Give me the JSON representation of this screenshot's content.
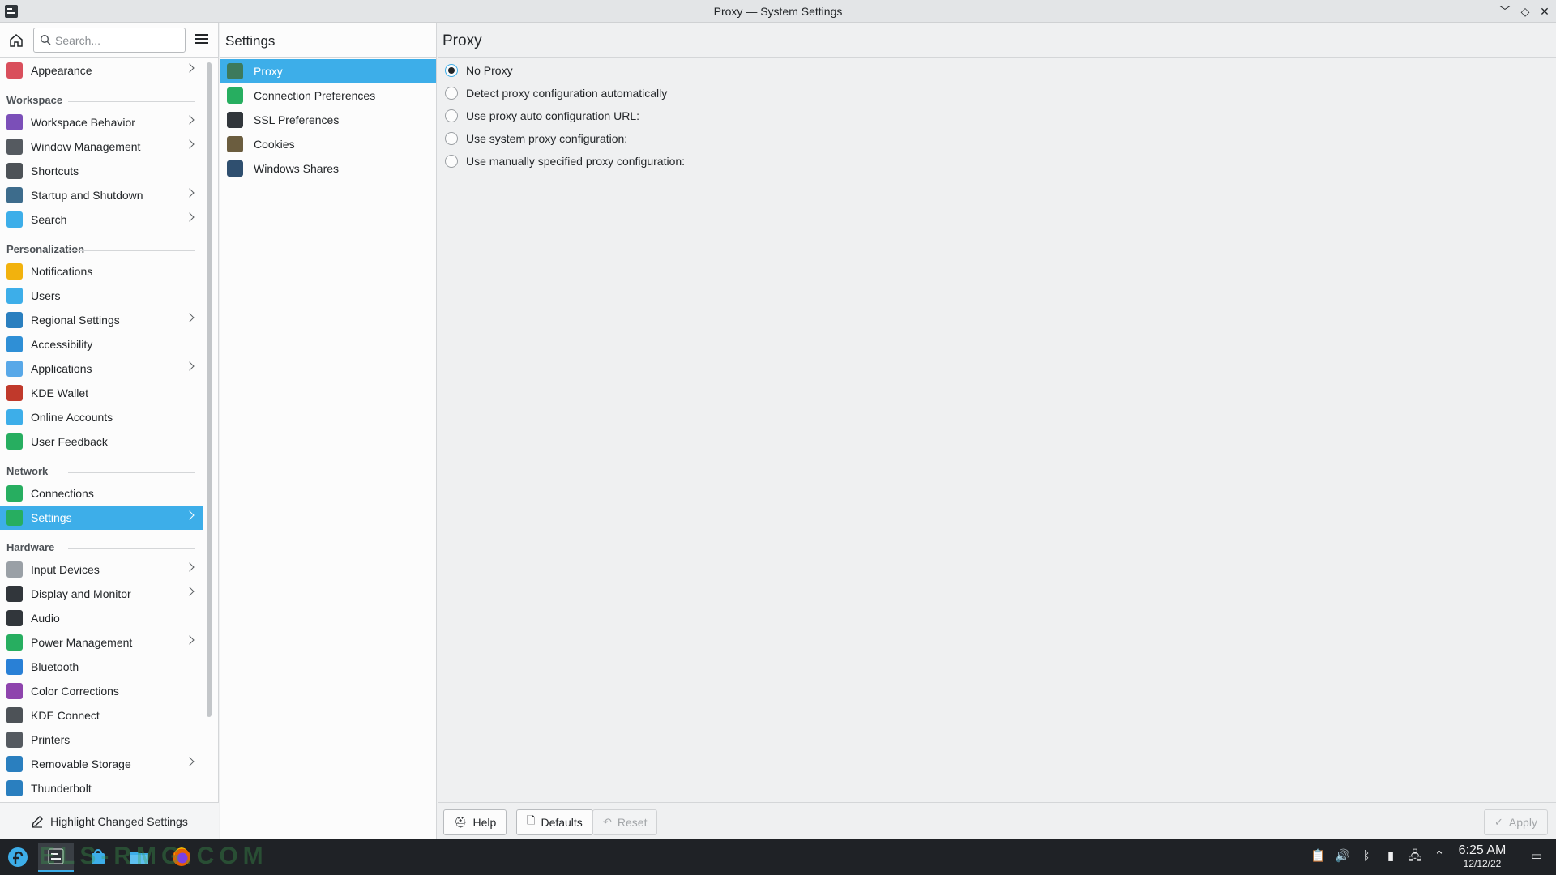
{
  "window": {
    "title": "Proxy — System Settings"
  },
  "sidebar": {
    "search_placeholder": "Search...",
    "sections": [
      {
        "category": "",
        "items": [
          {
            "label": "Appearance",
            "icon": "appearance-icon",
            "has_children": true,
            "color": "#d94f5c"
          }
        ]
      },
      {
        "category": "Workspace",
        "items": [
          {
            "label": "Workspace Behavior",
            "icon": "workspace-behavior-icon",
            "has_children": true,
            "color": "#7b4fb8"
          },
          {
            "label": "Window Management",
            "icon": "window-management-icon",
            "has_children": true,
            "color": "#555a60"
          },
          {
            "label": "Shortcuts",
            "icon": "keyboard-icon",
            "has_children": false,
            "color": "#4d5257"
          },
          {
            "label": "Startup and Shutdown",
            "icon": "startup-icon",
            "has_children": true,
            "color": "#3d6c8c"
          },
          {
            "label": "Search",
            "icon": "search-settings-icon",
            "has_children": true,
            "color": "#3daee9"
          }
        ]
      },
      {
        "category": "Personalization",
        "items": [
          {
            "label": "Notifications",
            "icon": "bell-icon",
            "has_children": false,
            "color": "#f2b20d"
          },
          {
            "label": "Users",
            "icon": "users-icon",
            "has_children": false,
            "color": "#3daee9"
          },
          {
            "label": "Regional Settings",
            "icon": "regional-settings-icon",
            "has_children": true,
            "color": "#2a7fbf"
          },
          {
            "label": "Accessibility",
            "icon": "accessibility-icon",
            "has_children": false,
            "color": "#2f8fd6"
          },
          {
            "label": "Applications",
            "icon": "applications-icon",
            "has_children": true,
            "color": "#58a8e8"
          },
          {
            "label": "KDE Wallet",
            "icon": "wallet-icon",
            "has_children": false,
            "color": "#c0392b"
          },
          {
            "label": "Online Accounts",
            "icon": "online-accounts-icon",
            "has_children": false,
            "color": "#3daee9"
          },
          {
            "label": "User Feedback",
            "icon": "user-feedback-icon",
            "has_children": false,
            "color": "#27ae60"
          }
        ]
      },
      {
        "category": "Network",
        "items": [
          {
            "label": "Connections",
            "icon": "globe-icon",
            "has_children": false,
            "color": "#27ae60"
          },
          {
            "label": "Settings",
            "icon": "network-settings-icon",
            "has_children": true,
            "selected": true,
            "color": "#27ae60"
          }
        ]
      },
      {
        "category": "Hardware",
        "items": [
          {
            "label": "Input Devices",
            "icon": "mouse-icon",
            "has_children": true,
            "color": "#9aa0a6"
          },
          {
            "label": "Display and Monitor",
            "icon": "monitor-icon",
            "has_children": true,
            "color": "#31363b"
          },
          {
            "label": "Audio",
            "icon": "speaker-icon",
            "has_children": false,
            "color": "#31363b"
          },
          {
            "label": "Power Management",
            "icon": "power-icon",
            "has_children": true,
            "color": "#27ae60"
          },
          {
            "label": "Bluetooth",
            "icon": "bluetooth-icon",
            "has_children": false,
            "color": "#2980d6"
          },
          {
            "label": "Color Corrections",
            "icon": "color-corrections-icon",
            "has_children": false,
            "color": "#8e44ad"
          },
          {
            "label": "KDE Connect",
            "icon": "phone-icon",
            "has_children": false,
            "color": "#4d5257"
          },
          {
            "label": "Printers",
            "icon": "printer-icon",
            "has_children": false,
            "color": "#555a60"
          },
          {
            "label": "Removable Storage",
            "icon": "usb-icon",
            "has_children": true,
            "color": "#2a7fbf"
          },
          {
            "label": "Thunderbolt",
            "icon": "thunderbolt-icon",
            "has_children": false,
            "color": "#2a7fbf"
          }
        ]
      }
    ],
    "footer_label": "Highlight Changed Settings"
  },
  "middle": {
    "title": "Settings",
    "items": [
      {
        "label": "Proxy",
        "icon": "proxy-icon",
        "selected": true,
        "color": "#3d7a5c"
      },
      {
        "label": "Connection Preferences",
        "icon": "globe-icon",
        "selected": false,
        "color": "#27ae60"
      },
      {
        "label": "SSL Preferences",
        "icon": "ssl-icon",
        "selected": false,
        "color": "#31363b"
      },
      {
        "label": "Cookies",
        "icon": "cookie-icon",
        "selected": false,
        "color": "#6b5d3f"
      },
      {
        "label": "Windows Shares",
        "icon": "windows-shares-icon",
        "selected": false,
        "color": "#2f4f6f"
      }
    ]
  },
  "content": {
    "title": "Proxy",
    "options": [
      {
        "label": "No Proxy",
        "checked": true
      },
      {
        "label": "Detect proxy configuration automatically",
        "checked": false
      },
      {
        "label": "Use proxy auto configuration URL:",
        "checked": false
      },
      {
        "label": "Use system proxy configuration:",
        "checked": false
      },
      {
        "label": "Use manually specified proxy configuration:",
        "checked": false
      }
    ],
    "buttons": {
      "help": "Help",
      "defaults": "Defaults",
      "reset": "Reset",
      "apply": "Apply"
    }
  },
  "taskbar": {
    "watermark": "ELS-RMG.COM",
    "time": "6:25 AM",
    "date": "12/12/22",
    "accent": "#3daee9"
  }
}
